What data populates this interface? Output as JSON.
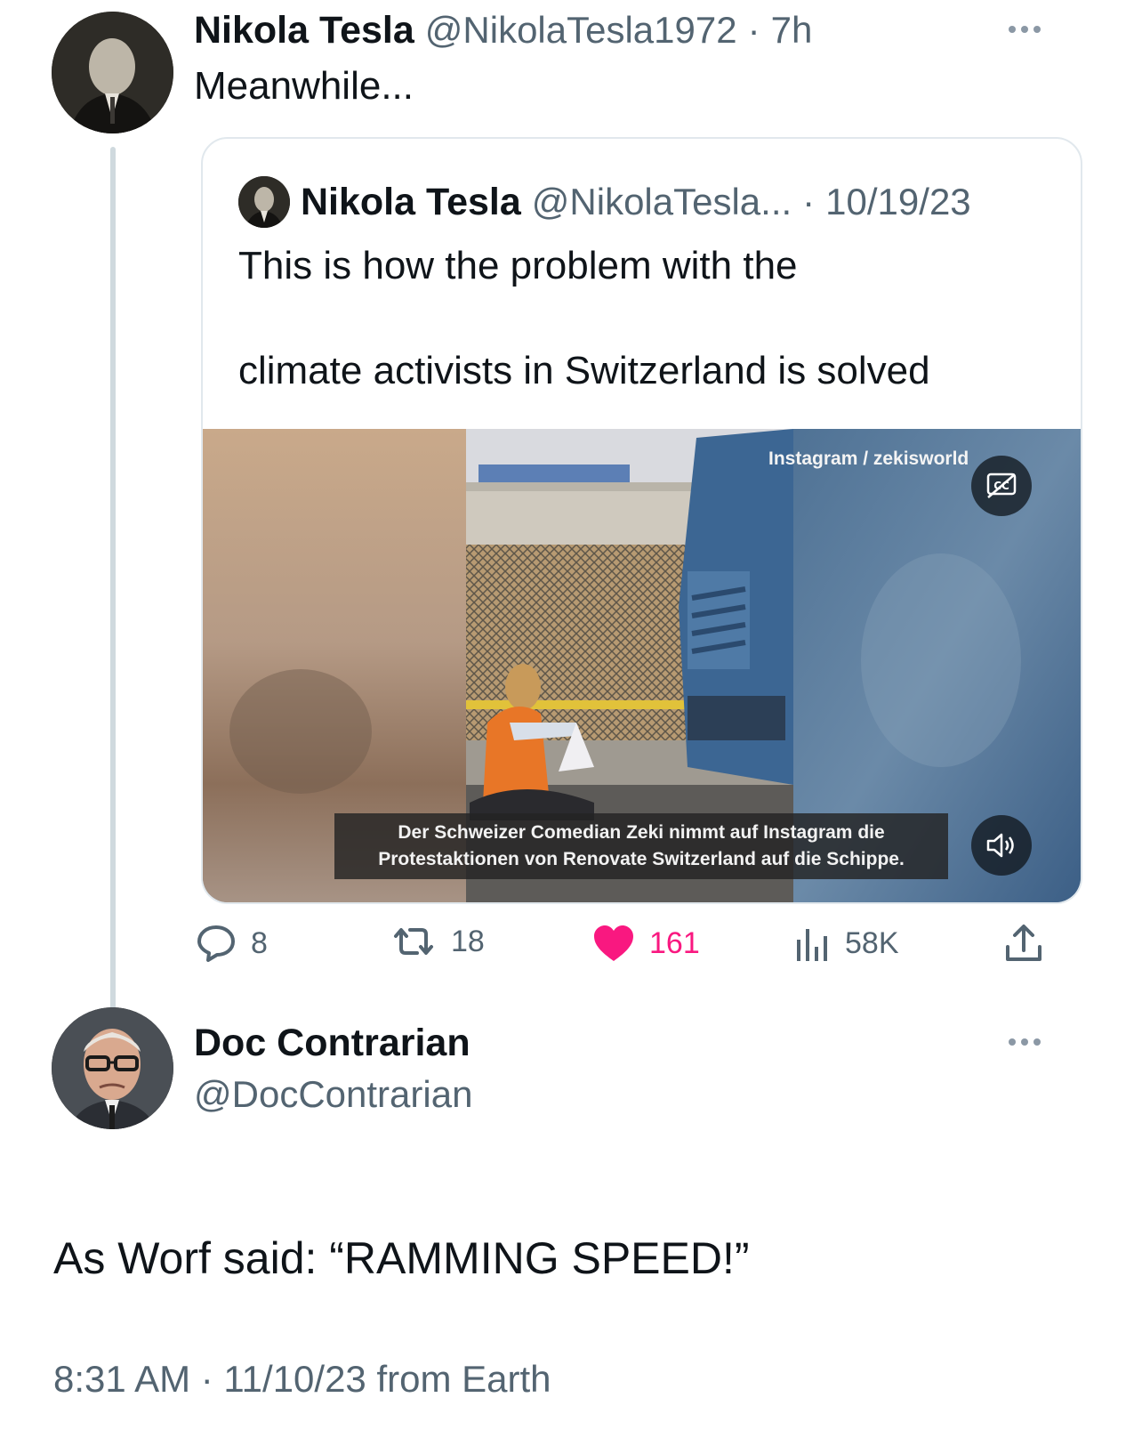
{
  "tweet": {
    "author_name": "Nikola Tesla",
    "author_handle": "@NikolaTesla1972",
    "separator": "·",
    "time": "7h",
    "text": "Meanwhile...",
    "more_icon": "more-horizontal-icon"
  },
  "quoted_tweet": {
    "author_name": "Nikola Tesla",
    "author_handle": "@NikolaTesla...",
    "separator": "·",
    "date": "10/19/23",
    "text_line1": "This is how the problem with the",
    "text_line2": "climate activists in Switzerland is solved",
    "media": {
      "watermark": "Instagram / zekisworld",
      "caption_line1": "Der Schweizer Comedian Zeki nimmt auf Instagram die",
      "caption_line2": "Protestaktionen von Renovate Switzerland auf die Schippe.",
      "captions_icon": "closed-captions-icon",
      "volume_icon": "speaker-icon"
    }
  },
  "actions": {
    "replies": "8",
    "retweets": "18",
    "likes": "161",
    "views": "58K",
    "like_color": "#f91880"
  },
  "reply": {
    "author_name": "Doc Contrarian",
    "author_handle": "@DocContrarian",
    "text": "As Worf said: “RAMMING SPEED!”",
    "timestamp": "8:31 AM · 11/10/23 from Earth"
  }
}
